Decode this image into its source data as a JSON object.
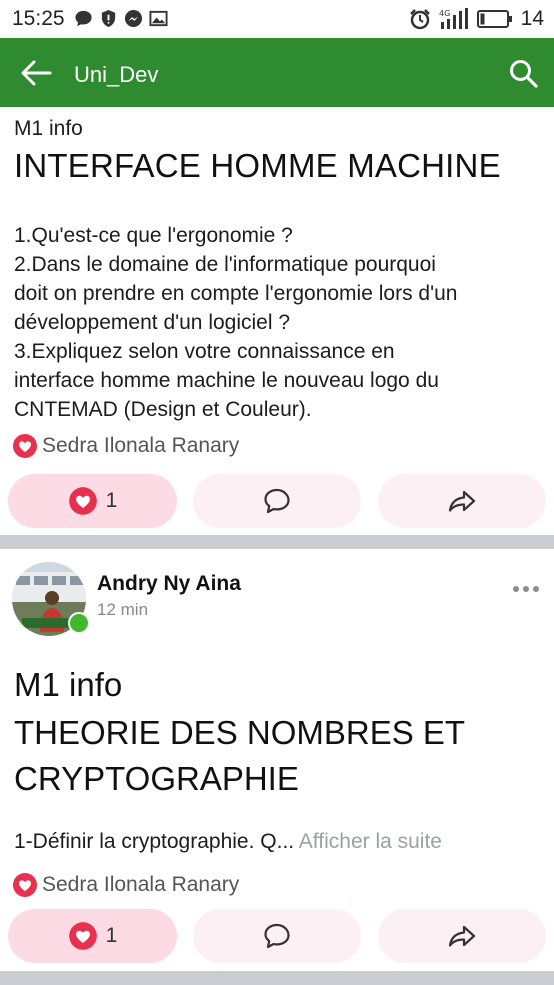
{
  "status_bar": {
    "time": "15:25",
    "battery": "14",
    "network": "4G"
  },
  "app_bar": {
    "title": "Uni_Dev"
  },
  "post1": {
    "tag": "M1 info",
    "title": "INTERFACE HOMME MACHINE",
    "body_lines": [
      "1.Qu'est-ce que l'ergonomie ?",
      "2.Dans le domaine de l'informatique pourquoi",
      "doit on prendre en compte l'ergonomie lors d'un",
      "développement d'un logiciel ?",
      "3.Expliquez selon votre connaissance en",
      "interface homme machine le nouveau logo du",
      "CNTEMAD (Design et Couleur)."
    ],
    "reactor": "Sedra Ilonala Ranary",
    "like_count": "1"
  },
  "post2": {
    "author": "Andry Ny Aina",
    "time": "12 min",
    "tag": "M1 info",
    "title_lines": [
      "THEORIE DES NOMBRES ET",
      "CRYPTOGRAPHIE"
    ],
    "snippet": "1-Définir la cryptographie. Q... ",
    "see_more": "Afficher la suite",
    "reactor": "Sedra Ilonala Ranary",
    "like_count": "1"
  },
  "colors": {
    "app_bar": "#2e8b30",
    "like_red": "#e8314f",
    "divider": "#c9ccd1",
    "online": "#42b72a"
  }
}
